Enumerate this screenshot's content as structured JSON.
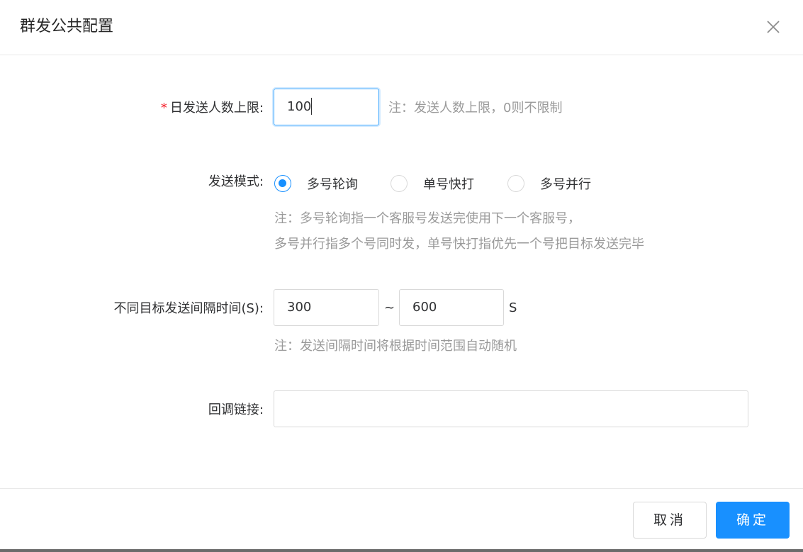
{
  "dialog": {
    "title": "群发公共配置",
    "close_icon": "close-icon"
  },
  "form": {
    "daily_limit": {
      "required_mark": "*",
      "label": "日发送人数上限:",
      "value": "100",
      "note": "注：发送人数上限，0则不限制"
    },
    "send_mode": {
      "label": "发送模式:",
      "options": [
        {
          "label": "多号轮询",
          "checked": true
        },
        {
          "label": "单号快打",
          "checked": false
        },
        {
          "label": "多号并行",
          "checked": false
        }
      ],
      "note_line1": "注：多号轮询指一个客服号发送完使用下一个客服号，",
      "note_line2": "多号并行指多个号同时发，单号快打指优先一个号把目标发送完毕"
    },
    "interval": {
      "label": "不同目标发送间隔时间(S):",
      "min_value": "300",
      "separator": "~",
      "max_value": "600",
      "unit": "S",
      "note": "注：发送间隔时间将根据时间范围自动随机"
    },
    "callback": {
      "label": "回调链接:",
      "value": ""
    }
  },
  "footer": {
    "cancel_label": "取消",
    "ok_label": "确定"
  },
  "colors": {
    "primary": "#1890ff",
    "required": "#f5222d",
    "note": "#9a9a9a"
  }
}
